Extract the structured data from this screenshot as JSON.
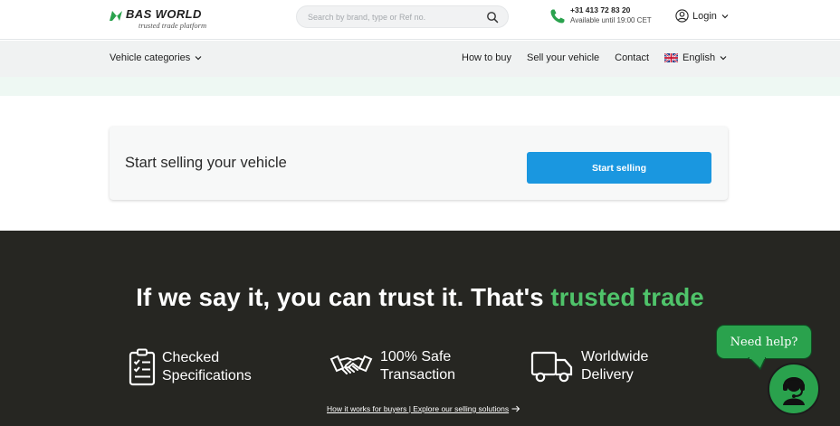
{
  "header": {
    "logo_name": "BAS WORLD",
    "logo_tagline": "trusted trade platform",
    "search_placeholder": "Search by brand, type or Ref no.",
    "phone_number": "+31 413 72 83 20",
    "phone_hours": "Available until 19:00 CET",
    "login_label": "Login"
  },
  "nav": {
    "categories_label": "Vehicle categories",
    "links": [
      "How to buy",
      "Sell your vehicle",
      "Contact"
    ],
    "language_label": "English"
  },
  "sell_card": {
    "title": "Start selling your vehicle",
    "button_label": "Start selling"
  },
  "trust": {
    "heading_main": "If we say it, you can trust it. That's ",
    "heading_accent": "trusted trade",
    "features": [
      {
        "line1": "Checked",
        "line2": "Specifications",
        "icon": "checklist-icon"
      },
      {
        "line1": "100% Safe",
        "line2": "Transaction",
        "icon": "handshake-icon"
      },
      {
        "line1": "Worldwide",
        "line2": "Delivery",
        "icon": "truck-icon"
      }
    ],
    "footer_links": "How it works for buyers | Explore our selling solutions"
  },
  "help": {
    "bubble_label": "Need help?",
    "avatar_icon": "support-agent-icon"
  },
  "colors": {
    "brand_green": "#2aa24d",
    "accent_green": "#4fc36a",
    "button_blue": "#1a97e0",
    "dark_section": "#262622"
  }
}
